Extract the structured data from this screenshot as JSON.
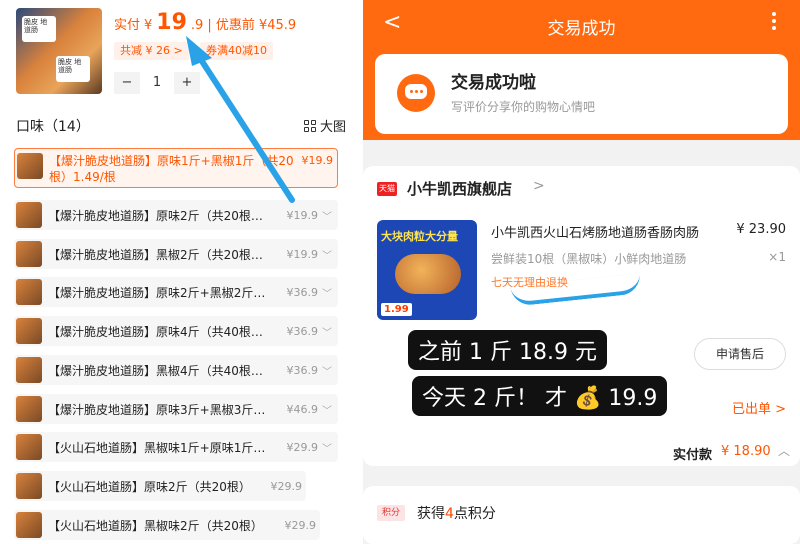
{
  "left": {
    "thumb_tag": "脆皮\n地道肠",
    "price_label": "实付",
    "price_currency": "¥",
    "price_big": "19",
    "price_small": ".9",
    "before_label": "| 优惠前 ¥45.9",
    "chip_total": "共减 ¥ 26 >",
    "chip_coupon": "券满40减10",
    "qty_minus": "−",
    "qty_value": "1",
    "qty_plus": "+",
    "flavor_heading": "口味（14）",
    "big_image_label": "大图",
    "options": [
      {
        "text": "【爆汁脆皮地道肠】原味1斤+黑椒1斤（共20根）1.49/根",
        "price": "¥19.9",
        "selected": true
      },
      {
        "text": "【爆汁脆皮地道肠】原味2斤（共20根…",
        "price": "¥19.9"
      },
      {
        "text": "【爆汁脆皮地道肠】黑椒2斤（共20根…",
        "price": "¥19.9"
      },
      {
        "text": "【爆汁脆皮地道肠】原味2斤+黑椒2斤…",
        "price": "¥36.9"
      },
      {
        "text": "【爆汁脆皮地道肠】原味4斤（共40根…",
        "price": "¥36.9"
      },
      {
        "text": "【爆汁脆皮地道肠】黑椒4斤（共40根…",
        "price": "¥36.9"
      },
      {
        "text": "【爆汁脆皮地道肠】原味3斤+黑椒3斤…",
        "price": "¥46.9"
      },
      {
        "text": "【火山石地道肠】黑椒味1斤+原味1斤…",
        "price": "¥29.9"
      },
      {
        "text": "【火山石地道肠】原味2斤（共20根）",
        "price": "¥29.9"
      },
      {
        "text": "【火山石地道肠】黑椒味2斤（共20根）",
        "price": "¥29.9"
      }
    ]
  },
  "right": {
    "header_title": "交易成功",
    "back_glyph": "<",
    "success_title": "交易成功啦",
    "success_sub": "写评价分享你的购物心情吧",
    "tmall_badge": "天猫",
    "shop_name": "小牛凯西旗舰店",
    "shop_chevron": ">",
    "item_image_banner": "大块肉粒大分量",
    "item_image_price": "1.99",
    "item_name": "小牛凯西火山石烤肠地道肠香肠肉肠",
    "item_price": "¥ 23.90",
    "item_spec": "尝鲜装10根（黑椒味）小鲜肉地道肠",
    "item_qty": "×1",
    "item_tag": "七天无理由退换",
    "after_sale_button": "申请售后",
    "shipped_label": "已出单 >",
    "paid_label": "实付款",
    "paid_value": "¥ 18.90",
    "paid_chevron": "︿",
    "points_badge": "积分",
    "points_pre": "获得",
    "points_num": "4",
    "points_post": "点积分"
  },
  "captions": {
    "line1": "之前 1 斤 18.9 元",
    "line2": "今天 2 斤！ 才 💰 19.9"
  },
  "colors": {
    "accent": "#ff6a10",
    "price": "#ff5500",
    "arrow": "#2aa2e8"
  }
}
